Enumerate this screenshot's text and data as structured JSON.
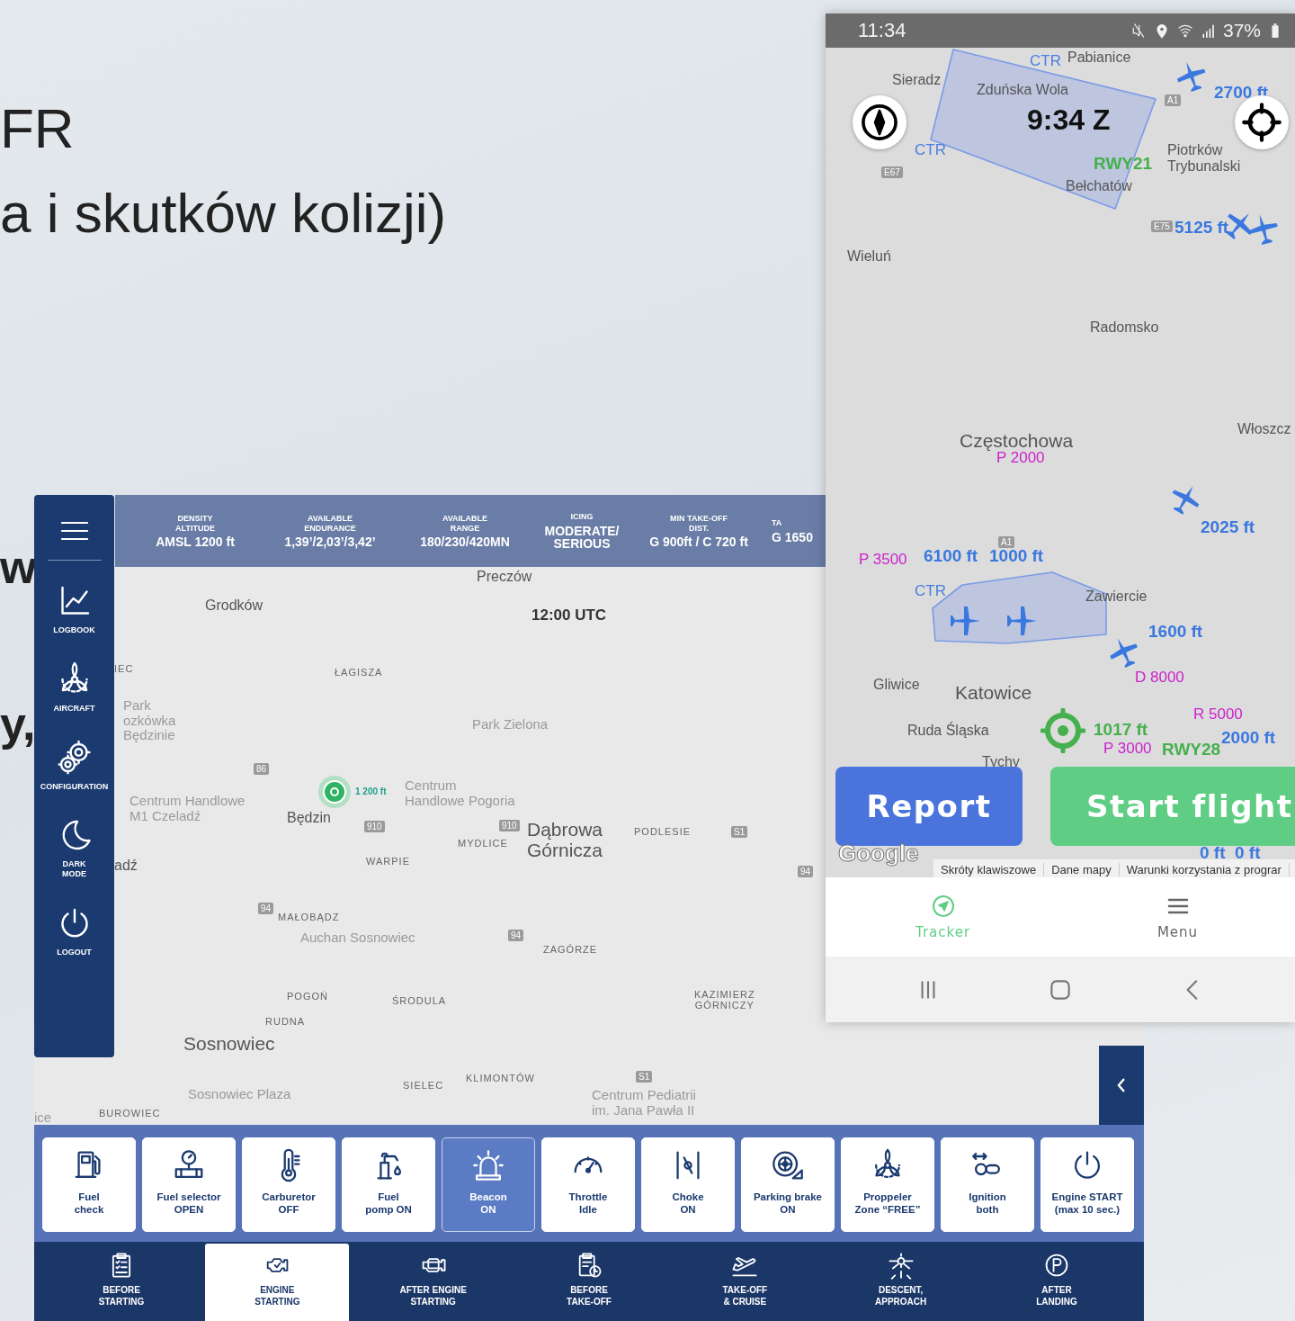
{
  "slide": {
    "lines": [
      {
        "text": "FR",
        "kind": "title"
      },
      {
        "text": "a i skutków kolizji)",
        "kind": "title"
      },
      {
        "text": "w",
        "kind": "bullet"
      },
      {
        "text": "y,",
        "kind": "bullet"
      }
    ]
  },
  "tablet": {
    "sidebar": {
      "items": [
        {
          "label": "LOGBOOK",
          "kind": "chart"
        },
        {
          "label": "AIRCRAFT",
          "kind": "propeller"
        },
        {
          "label": "CONFIGURATION",
          "kind": "gears"
        },
        {
          "label": "DARK\nMODE",
          "kind": "moon"
        },
        {
          "label": "LOGOUT",
          "kind": "power"
        }
      ]
    },
    "topbar": {
      "stats": [
        {
          "label": "DENSITY\nALTITUDE",
          "value": "AMSL 1200 ft"
        },
        {
          "label": "AVAILABLE\nENDURANCE",
          "value": "1,39’/2,03’/3,42’"
        },
        {
          "label": "AVAILABLE\nRANGE",
          "value": "180/230/420MN"
        },
        {
          "label": "ICING",
          "value": "MODERATE/\nSERIOUS"
        },
        {
          "label": "MIN TAKE-OFF\nDIST.",
          "value": "G 900ft / C 720 ft"
        },
        {
          "label": "TA",
          "value": "G 1650"
        }
      ]
    },
    "map": {
      "time": "12:00 UTC",
      "position_label": "1 200 ft",
      "labels": [
        {
          "text": "Preczów",
          "kind": "city"
        },
        {
          "text": "Grodków",
          "kind": "city"
        },
        {
          "text": "ŁAGISZA",
          "kind": "district"
        },
        {
          "text": "IEC",
          "kind": "district"
        },
        {
          "text": "Park\nozkówka\nBędzinie",
          "kind": "poi"
        },
        {
          "text": "Park Zielona",
          "kind": "poi"
        },
        {
          "text": "86",
          "kind": "road"
        },
        {
          "text": "Centrum\nHandlowe Pogoria",
          "kind": "poi"
        },
        {
          "text": "Centrum Handlowe\nM1 Czeladź",
          "kind": "poi"
        },
        {
          "text": "Będzin",
          "kind": "city"
        },
        {
          "text": "910",
          "kind": "road"
        },
        {
          "text": "910",
          "kind": "road"
        },
        {
          "text": "Dąbrowa\nGórnicza",
          "kind": "major"
        },
        {
          "text": "PODLESIE",
          "kind": "district"
        },
        {
          "text": "S1",
          "kind": "road"
        },
        {
          "text": "MYDLICE",
          "kind": "district"
        },
        {
          "text": "WARPIE",
          "kind": "district"
        },
        {
          "text": "adź",
          "kind": "city"
        },
        {
          "text": "94",
          "kind": "road"
        },
        {
          "text": "94",
          "kind": "road"
        },
        {
          "text": "94",
          "kind": "road"
        },
        {
          "text": "MAŁOBĄDZ",
          "kind": "district"
        },
        {
          "text": "Auchan Sosnowiec",
          "kind": "poi"
        },
        {
          "text": "ZAGÓRZE",
          "kind": "district"
        },
        {
          "text": "POGOŃ",
          "kind": "district"
        },
        {
          "text": "ŚRODULA",
          "kind": "district"
        },
        {
          "text": "KAZIMIERZ\nGÓRNICZY",
          "kind": "district"
        },
        {
          "text": "RUDNA",
          "kind": "district"
        },
        {
          "text": "Sosnowiec",
          "kind": "major"
        },
        {
          "text": "S1",
          "kind": "road"
        },
        {
          "text": "KLIMONTÓW",
          "kind": "district"
        },
        {
          "text": "SIELEC",
          "kind": "district"
        },
        {
          "text": "Sosnowiec Plaza",
          "kind": "poi"
        },
        {
          "text": "Centrum Pediatrii\nim. Jana Pawła II",
          "kind": "poi"
        },
        {
          "text": "ice",
          "kind": "poi"
        },
        {
          "text": "BUROWIEC",
          "kind": "district"
        }
      ]
    },
    "checklist": [
      {
        "label": "Fuel\ncheck",
        "kind": "fuel",
        "selected": false
      },
      {
        "label": "Fuel selector\nOPEN",
        "kind": "valve",
        "selected": false
      },
      {
        "label": "Carburetor\nOFF",
        "kind": "thermometer",
        "selected": false
      },
      {
        "label": "Fuel\npomp ON",
        "kind": "pump",
        "selected": false
      },
      {
        "label": "Beacon\nON",
        "kind": "beacon",
        "selected": true
      },
      {
        "label": "Throttle\nIdle",
        "kind": "speedometer",
        "selected": false
      },
      {
        "label": "Choke\nON",
        "kind": "choke",
        "selected": false
      },
      {
        "label": "Parking brake\nON",
        "kind": "wheel",
        "selected": false
      },
      {
        "label": "Proppeler\nZone “FREE”",
        "kind": "propeller",
        "selected": false
      },
      {
        "label": "Ignition\nboth",
        "kind": "key",
        "selected": false
      },
      {
        "label": "Engine START\n(max 10 sec.)",
        "kind": "power",
        "selected": false
      }
    ],
    "phases": [
      {
        "label": "BEFORE\nSTARTING",
        "kind": "clipboard",
        "selected": false
      },
      {
        "label": "ENGINE\nSTARTING",
        "kind": "engine",
        "selected": true
      },
      {
        "label": "AFTER ENGINE\nSTARTING",
        "kind": "engine-test",
        "selected": false
      },
      {
        "label": "BEFORE\nTAKE-OFF",
        "kind": "clipboard-clock",
        "selected": false
      },
      {
        "label": "TAKE-OFF\n& CRUISE",
        "kind": "takeoff",
        "selected": false
      },
      {
        "label": "DESCENT,\nAPPROACH",
        "kind": "descent",
        "selected": false
      },
      {
        "label": "AFTER\nLANDING",
        "kind": "parking",
        "selected": false
      }
    ]
  },
  "phone": {
    "status_bar": {
      "time": "11:34",
      "battery": "37%"
    },
    "map": {
      "clock": "9:34 Z",
      "labels": [
        {
          "text": "Pabianice",
          "kind": "city"
        },
        {
          "text": "CTR",
          "kind": "ctr"
        },
        {
          "text": "Sieradz",
          "kind": "city"
        },
        {
          "text": "Zduńska Wola",
          "kind": "city"
        },
        {
          "text": "A1",
          "kind": "road"
        },
        {
          "text": "2700 ft",
          "kind": "altitude"
        },
        {
          "text": "CTR",
          "kind": "ctr"
        },
        {
          "text": "E67",
          "kind": "road"
        },
        {
          "text": "RWY21",
          "kind": "runway"
        },
        {
          "text": "Piotrków\nTrybunalski",
          "kind": "city"
        },
        {
          "text": "Bełchatów",
          "kind": "city"
        },
        {
          "text": "E75",
          "kind": "road"
        },
        {
          "text": "5125 ft",
          "kind": "altitude"
        },
        {
          "text": "Wieluń",
          "kind": "city"
        },
        {
          "text": "Radomsko",
          "kind": "city"
        },
        {
          "text": "Włoszcz",
          "kind": "city"
        },
        {
          "text": "Częstochowa",
          "kind": "major"
        },
        {
          "text": "P 2000",
          "kind": "zone"
        },
        {
          "text": "2025 ft",
          "kind": "altitude"
        },
        {
          "text": "A1",
          "kind": "road"
        },
        {
          "text": "P 3500",
          "kind": "zone"
        },
        {
          "text": "6100 ft",
          "kind": "altitude"
        },
        {
          "text": "1000 ft",
          "kind": "altitude"
        },
        {
          "text": "CTR",
          "kind": "ctr"
        },
        {
          "text": "Zawiercie",
          "kind": "city"
        },
        {
          "text": "1600 ft",
          "kind": "altitude"
        },
        {
          "text": "D 8000",
          "kind": "zone"
        },
        {
          "text": "Gliwice",
          "kind": "city"
        },
        {
          "text": "Katowice",
          "kind": "major"
        },
        {
          "text": "Ruda Śląska",
          "kind": "city"
        },
        {
          "text": "R 5000",
          "kind": "zone"
        },
        {
          "text": "1017 ft",
          "kind": "runway"
        },
        {
          "text": "RWY28",
          "kind": "runway"
        },
        {
          "text": "2000 ft",
          "kind": "altitude"
        },
        {
          "text": "P 3000",
          "kind": "zone"
        },
        {
          "text": "Tychy",
          "kind": "city"
        },
        {
          "text": "0 ft",
          "kind": "altitude"
        },
        {
          "text": "0 ft",
          "kind": "altitude"
        }
      ]
    },
    "buttons": [
      {
        "label": "Report",
        "kind": "report"
      },
      {
        "label": "Start flight",
        "kind": "start"
      }
    ],
    "attribution": {
      "logo": "Google",
      "links": [
        "Skróty klawiszowe",
        "Dane mapy",
        "Warunki korzystania z prograr"
      ]
    },
    "nav": [
      {
        "label": "Tracker",
        "kind": "tracker",
        "selected": true
      },
      {
        "label": "Menu",
        "kind": "menu",
        "selected": false
      }
    ]
  }
}
